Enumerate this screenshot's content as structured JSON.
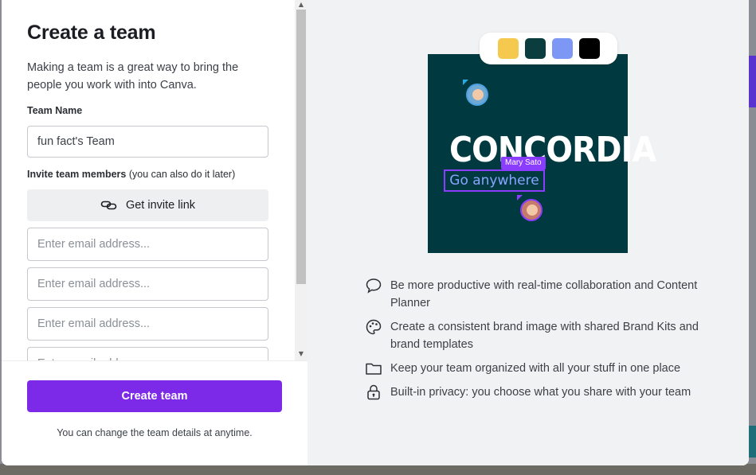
{
  "modal": {
    "title": "Create a team",
    "intro": "Making a team is a great way to bring the people you work with into Canva.",
    "team_name_label": "Team Name",
    "team_name_value": "fun fact's Team",
    "invite_label_bold": "Invite team members",
    "invite_label_rest": " (you can also do it later)",
    "invite_link_button": "Get invite link",
    "email_placeholder": "Enter email address...",
    "email_fields": [
      "",
      "",
      "",
      ""
    ],
    "create_button": "Create team",
    "footer_note": "You can change the team details at anytime."
  },
  "preview": {
    "brand_text": "CONCORDIA",
    "tagline": "Go anywhere",
    "collaborator_name": "Mary Sato",
    "palette_colors": [
      "#f5c94e",
      "#0b3d3f",
      "#7d97f5",
      "#000000"
    ],
    "card_color": "#003a40"
  },
  "features": [
    {
      "icon": "speech-bubble-icon",
      "text": "Be more productive with real-time collaboration and Content Planner"
    },
    {
      "icon": "palette-icon",
      "text": "Create a consistent brand image with shared Brand Kits and brand templates"
    },
    {
      "icon": "folder-icon",
      "text": "Keep your team organized with all your stuff in one place"
    },
    {
      "icon": "lock-icon",
      "text": "Built-in privacy: you choose what you share with your team"
    }
  ],
  "colors": {
    "accent": "#7d2ae8",
    "tag_purple": "#8b3dff"
  }
}
